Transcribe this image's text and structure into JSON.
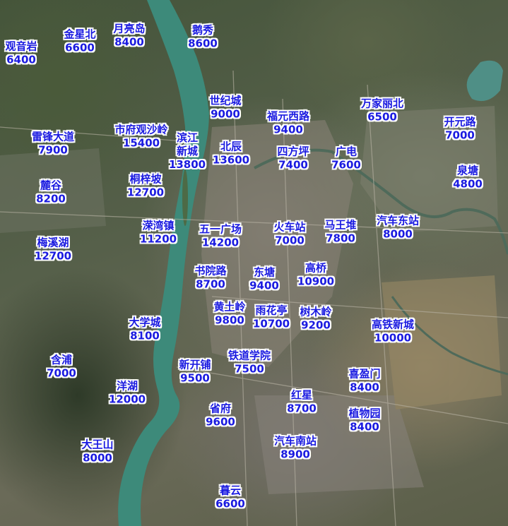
{
  "map": {
    "river_color": "#3d8a7a",
    "label_color": "#1a1ae0",
    "labels": [
      {
        "name": "观音岩",
        "price": "6400"
      },
      {
        "name": "金星北",
        "price": "6600"
      },
      {
        "name": "月亮岛",
        "price": "8400"
      },
      {
        "name": "鹅秀",
        "price": "8600"
      },
      {
        "name": "世纪城",
        "price": "9000"
      },
      {
        "name": "福元西路",
        "price": "9400"
      },
      {
        "name": "万家丽北",
        "price": "6500"
      },
      {
        "name": "开元路",
        "price": "7000"
      },
      {
        "name": "雷锋大道",
        "price": "7900"
      },
      {
        "name": "市府观沙岭",
        "price": "15400"
      },
      {
        "name": "滨江新城",
        "price": "13800"
      },
      {
        "name": "北辰",
        "price": "13600"
      },
      {
        "name": "四方坪",
        "price": "7400"
      },
      {
        "name": "广电",
        "price": "7600"
      },
      {
        "name": "泉塘",
        "price": "4800"
      },
      {
        "name": "麓谷",
        "price": "8200"
      },
      {
        "name": "桐梓坡",
        "price": "12700"
      },
      {
        "name": "溁湾镇",
        "price": "11200"
      },
      {
        "name": "五一广场",
        "price": "14200"
      },
      {
        "name": "火车站",
        "price": "7000"
      },
      {
        "name": "马王堆",
        "price": "7800"
      },
      {
        "name": "汽车东站",
        "price": "8000"
      },
      {
        "name": "梅溪湖",
        "price": "12700"
      },
      {
        "name": "书院路",
        "price": "8700"
      },
      {
        "name": "东塘",
        "price": "9400"
      },
      {
        "name": "高桥",
        "price": "10900"
      },
      {
        "name": "黄土岭",
        "price": "9800"
      },
      {
        "name": "雨花亭",
        "price": "10700"
      },
      {
        "name": "树木岭",
        "price": "9200"
      },
      {
        "name": "大学城",
        "price": "8100"
      },
      {
        "name": "高铁新城",
        "price": "10000"
      },
      {
        "name": "含浦",
        "price": "7000"
      },
      {
        "name": "铁道学院",
        "price": "7500"
      },
      {
        "name": "新开铺",
        "price": "9500"
      },
      {
        "name": "喜盈门",
        "price": "8400"
      },
      {
        "name": "洋湖",
        "price": "12000"
      },
      {
        "name": "红星",
        "price": "8700"
      },
      {
        "name": "省府",
        "price": "9600"
      },
      {
        "name": "植物园",
        "price": "8400"
      },
      {
        "name": "汽车南站",
        "price": "8900"
      },
      {
        "name": "大王山",
        "price": "8000"
      },
      {
        "name": "暮云",
        "price": "6600"
      }
    ]
  }
}
